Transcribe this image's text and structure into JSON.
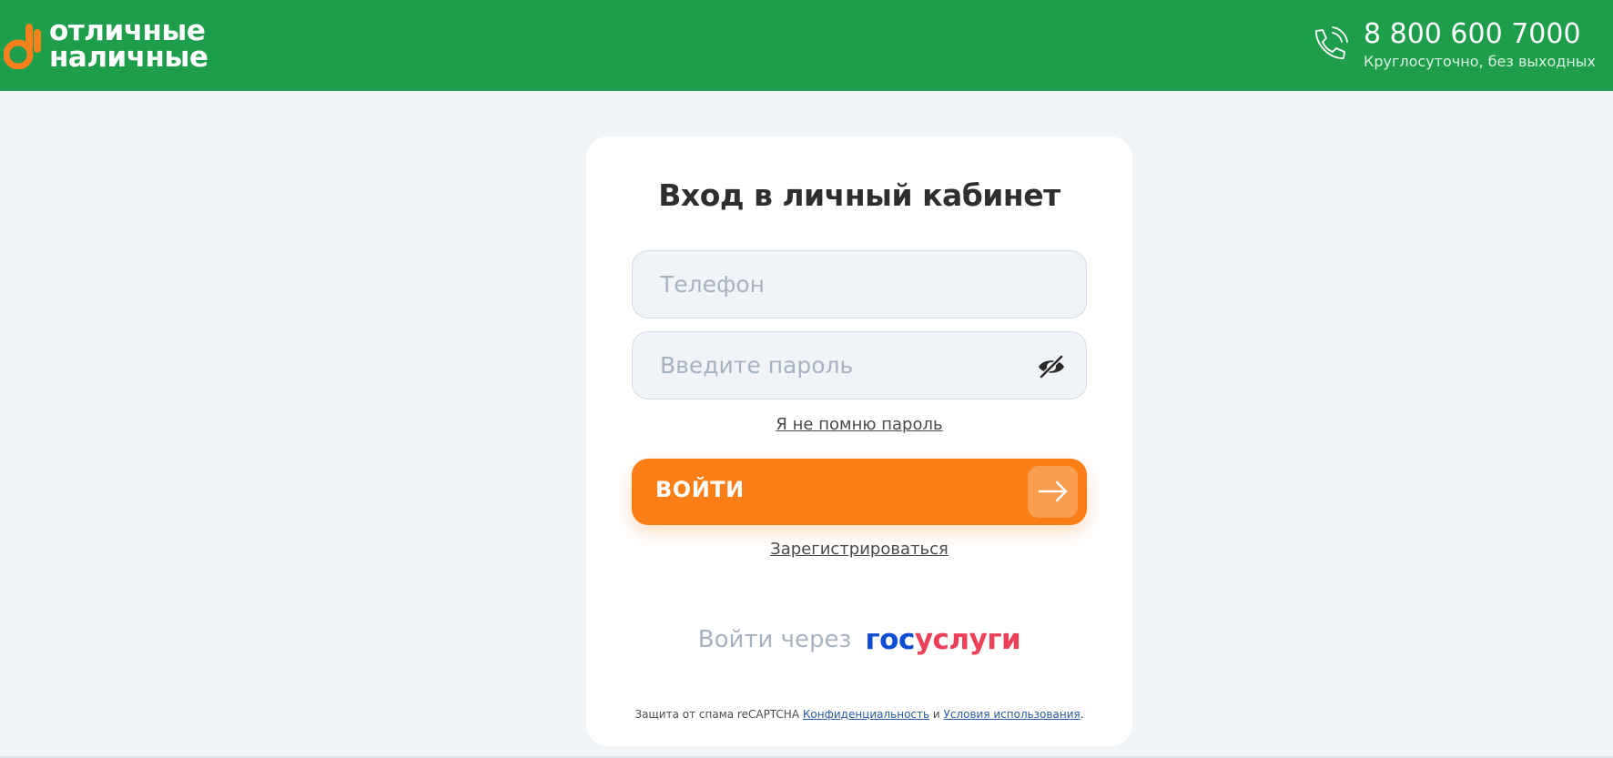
{
  "header": {
    "logo_line1": "отличные",
    "logo_line2": "наличные",
    "phone_number": "8 800 600 7000",
    "phone_hours": "Круглосуточно, без выходных"
  },
  "login": {
    "title": "Вход в личный кабинет",
    "phone_placeholder": "Телефон",
    "password_placeholder": "Введите пароль",
    "forgot_label": "Я не помню пароль",
    "submit_label": "ВОЙТИ",
    "register_label": "Зарегистрироваться",
    "gosuslugi_prefix": "Войти через",
    "gosuslugi_logo_part1": "гос",
    "gosuslugi_logo_part2": "услуги"
  },
  "recaptcha": {
    "text": "Защита от спама reCAPTCHA",
    "privacy": "Конфиденциальность",
    "and": "и",
    "terms": "Условия использования",
    "period": "."
  },
  "colors": {
    "brand_green": "#1e9e4a",
    "accent_orange": "#fa7d15",
    "gos_blue": "#0d4cd3",
    "gos_red": "#ee3f58"
  },
  "icons": {
    "logo": "ok-hand-icon",
    "phone": "phone-icon",
    "password_toggle": "eye-slash-icon",
    "submit": "arrow-right-icon"
  }
}
